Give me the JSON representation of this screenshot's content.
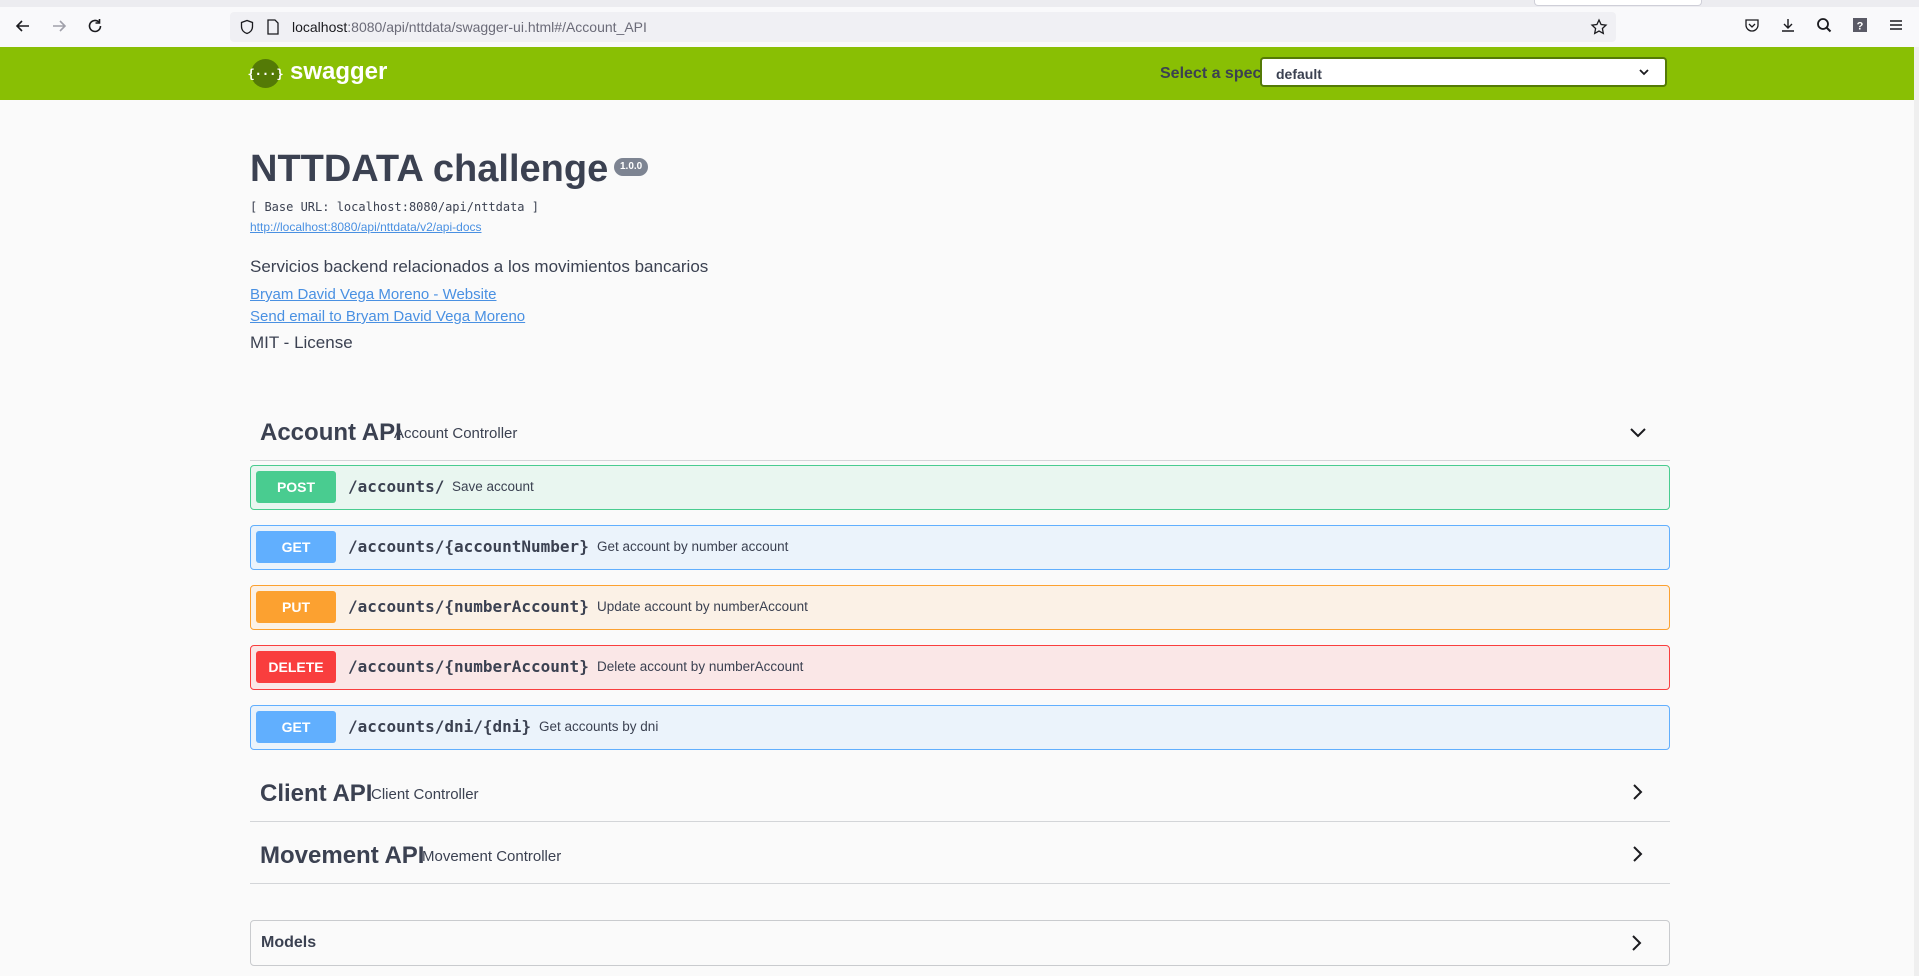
{
  "browser": {
    "url_host": "localhost",
    "url_rest": ":8080/api/nttdata/swagger-ui.html#/Account_API"
  },
  "topbar": {
    "logo_glyph": "{···}",
    "logo_text": "swagger",
    "spec_label": "Select a spec",
    "spec_value": "default",
    "color": "#89bf04"
  },
  "info": {
    "title": "NTTDATA challenge",
    "version": "1.0.0",
    "base_url": "[ Base URL: localhost:8080/api/nttdata ]",
    "docs_link": "http://localhost:8080/api/nttdata/v2/api-docs",
    "description": "Servicios backend relacionados a los movimientos bancarios",
    "website_link": "Bryam David Vega Moreno - Website",
    "email_link": "Send email to Bryam David Vega Moreno",
    "license": "MIT - License"
  },
  "tags": [
    {
      "name": "Account API",
      "description": "Account Controller",
      "expanded": true,
      "operations": [
        {
          "method": "POST",
          "path": "/accounts/",
          "summary": "Save account"
        },
        {
          "method": "GET",
          "path": "/accounts/{accountNumber}",
          "summary": "Get account by number account"
        },
        {
          "method": "PUT",
          "path": "/accounts/{numberAccount}",
          "summary": "Update account by numberAccount"
        },
        {
          "method": "DELETE",
          "path": "/accounts/{numberAccount}",
          "summary": "Delete account by numberAccount"
        },
        {
          "method": "GET",
          "path": "/accounts/dni/{dni}",
          "summary": "Get accounts by dni"
        }
      ]
    },
    {
      "name": "Client API",
      "description": "Client Controller",
      "expanded": false
    },
    {
      "name": "Movement API",
      "description": "Movement Controller",
      "expanded": false
    }
  ],
  "models": {
    "label": "Models"
  },
  "colors": {
    "post": "#49cc90",
    "get": "#61affe",
    "put": "#fca130",
    "delete": "#f93e3e",
    "link": "#4990e2",
    "text": "#3b4151"
  }
}
